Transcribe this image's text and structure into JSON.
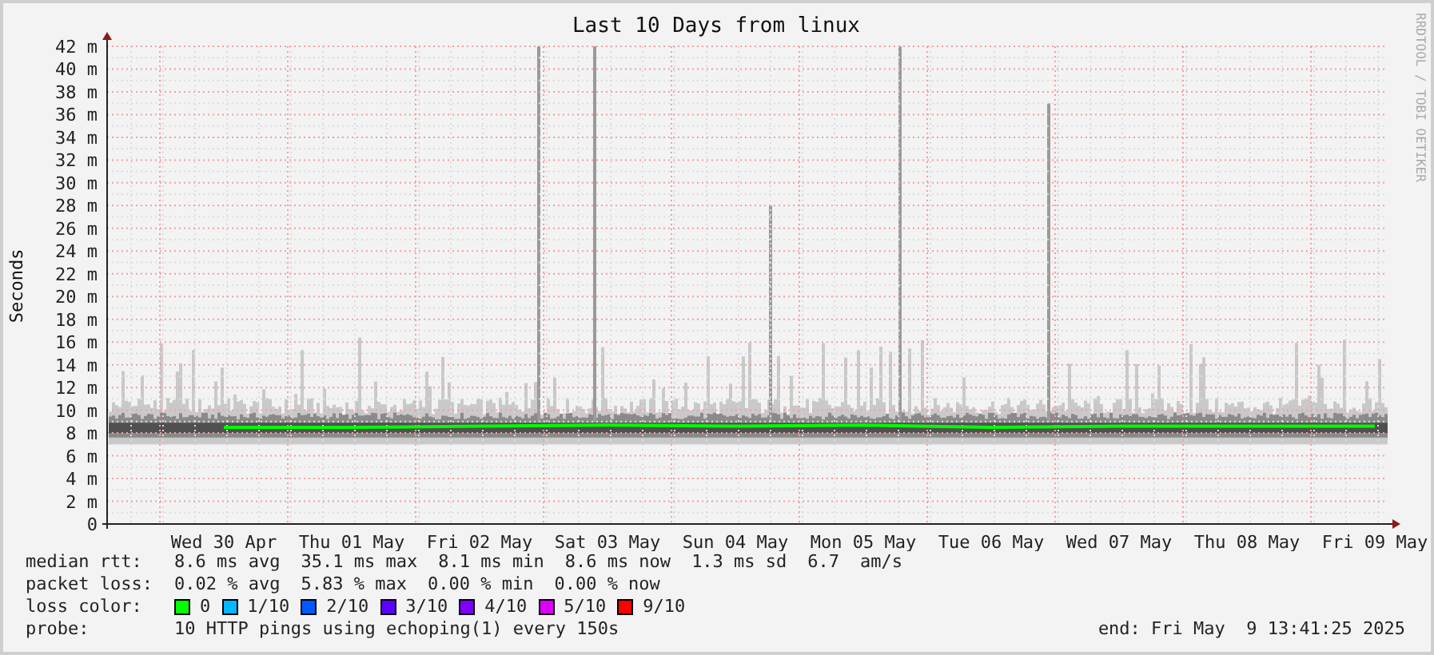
{
  "title": "Last 10 Days from linux",
  "credit": "RRDTOOL / TOBI OETIKER",
  "chart": {
    "chart_data": {
      "type": "line",
      "grid": true,
      "ylabel": "Seconds",
      "categories": [
        "Wed 30 Apr",
        "Thu 01 May",
        "Fri 02 May",
        "Sat 03 May",
        "Sun 04 May",
        "Mon 05 May",
        "Tue 06 May",
        "Wed 07 May",
        "Thu 08 May",
        "Fri 09 May"
      ],
      "ylim": [
        0,
        42
      ],
      "yticks": [
        {
          "value": 0,
          "label": "0"
        },
        {
          "value": 2,
          "label": "2 m"
        },
        {
          "value": 4,
          "label": "4 m"
        },
        {
          "value": 6,
          "label": "6 m"
        },
        {
          "value": 8,
          "label": "8 m"
        },
        {
          "value": 10,
          "label": "10 m"
        },
        {
          "value": 12,
          "label": "12 m"
        },
        {
          "value": 14,
          "label": "14 m"
        },
        {
          "value": 16,
          "label": "16 m"
        },
        {
          "value": 18,
          "label": "18 m"
        },
        {
          "value": 20,
          "label": "20 m"
        },
        {
          "value": 22,
          "label": "22 m"
        },
        {
          "value": 24,
          "label": "24 m"
        },
        {
          "value": 26,
          "label": "26 m"
        },
        {
          "value": 28,
          "label": "28 m"
        },
        {
          "value": 30,
          "label": "30 m"
        },
        {
          "value": 32,
          "label": "32 m"
        },
        {
          "value": 34,
          "label": "34 m"
        },
        {
          "value": 36,
          "label": "36 m"
        },
        {
          "value": 38,
          "label": "38 m"
        },
        {
          "value": 40,
          "label": "40 m"
        },
        {
          "value": 42,
          "label": "42 m"
        }
      ],
      "series": [
        {
          "color": "#00ff00",
          "values": [
            8.5,
            8.5,
            8.6,
            8.7,
            8.6,
            8.7,
            8.5,
            8.6,
            8.6,
            8.6
          ]
        }
      ]
    }
  },
  "legend": [
    {
      "label": "median rtt:",
      "values": [
        "8.6 ms avg",
        "35.1 ms max",
        "8.1 ms min",
        "8.6 ms now",
        "1.3 ms sd",
        "6.7",
        "am/s"
      ]
    },
    {
      "label": "packet loss:",
      "values": [
        "0.02 % avg",
        "5.83 % max",
        "0.00 % min",
        "0.00 % now"
      ]
    }
  ],
  "loss_colors": {
    "label": "loss color:",
    "items": [
      {
        "label": "0",
        "color": "#00ff00"
      },
      {
        "label": "1/10",
        "color": "#00b8ff"
      },
      {
        "label": "2/10",
        "color": "#0059ff"
      },
      {
        "label": "3/10",
        "color": "#5e00ff"
      },
      {
        "label": "4/10",
        "color": "#7e00ff"
      },
      {
        "label": "5/10",
        "color": "#dd00ff"
      },
      {
        "label": "9/10",
        "color": "#ff0000"
      }
    ]
  },
  "probe": {
    "label": "probe:",
    "text": "10 HTTP pings using echoping(1) every 150s"
  },
  "end": "end: Fri May  9 13:41:25 2025"
}
